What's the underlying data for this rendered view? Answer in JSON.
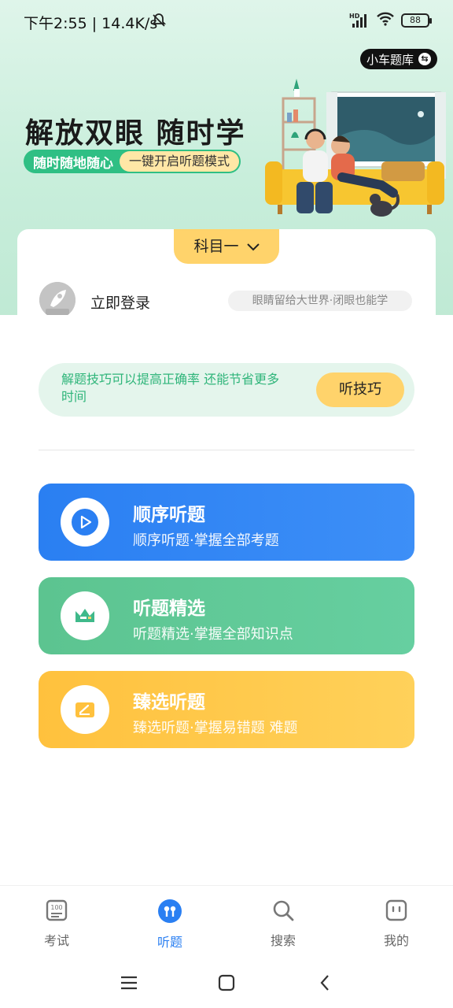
{
  "status_bar": {
    "time_speed": "下午2:55 | 14.4K/s",
    "signal_label": "HD",
    "battery": "88"
  },
  "header": {
    "question_bank_label": "小车题库"
  },
  "banner": {
    "title": "解放双眼 随时学",
    "tag_primary": "随时随地随心",
    "tag_secondary": "一键开启听题模式"
  },
  "card": {
    "subject": "科目一",
    "login": "立即登录",
    "slogan": "眼睛留给大世界·闭眼也能学"
  },
  "tip": {
    "text": "解题技巧可以提高正确率 还能节省更多时间",
    "button": "听技巧"
  },
  "features": [
    {
      "title": "顺序听题",
      "subtitle": "顺序听题·掌握全部考题",
      "icon": "play-icon",
      "color": "#2a7ff2"
    },
    {
      "title": "听题精选",
      "subtitle": "听题精选·掌握全部知识点",
      "icon": "crown-icon",
      "color": "#5cc490"
    },
    {
      "title": "臻选听题",
      "subtitle": "臻选听题·掌握易错题 难题",
      "icon": "pen-card-icon",
      "color": "#ffc13d"
    }
  ],
  "nav": [
    {
      "label": "考试",
      "icon": "exam-icon",
      "active": false
    },
    {
      "label": "听题",
      "icon": "earbuds-icon",
      "active": true
    },
    {
      "label": "搜索",
      "icon": "search-icon",
      "active": false
    },
    {
      "label": "我的",
      "icon": "profile-icon",
      "active": false
    }
  ],
  "colors": {
    "accent_blue": "#2a7ff2",
    "accent_green": "#2fbf84",
    "accent_yellow": "#ffd36b"
  }
}
